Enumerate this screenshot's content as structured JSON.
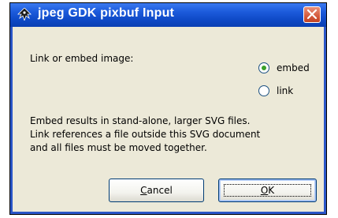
{
  "window": {
    "title": "jpeg GDK pixbuf Input",
    "app_icon": "inkscape-icon",
    "close_icon": "close-icon"
  },
  "dialog": {
    "prompt": "Link or embed image:",
    "options": [
      {
        "label": "embed",
        "selected": true
      },
      {
        "label": "link",
        "selected": false
      }
    ],
    "description_lines": [
      "Embed results in stand-alone, larger SVG files.",
      "Link references a file outside this SVG document",
      "and all files must be moved together."
    ],
    "buttons": {
      "cancel": "Cancel",
      "ok": "OK"
    }
  }
}
